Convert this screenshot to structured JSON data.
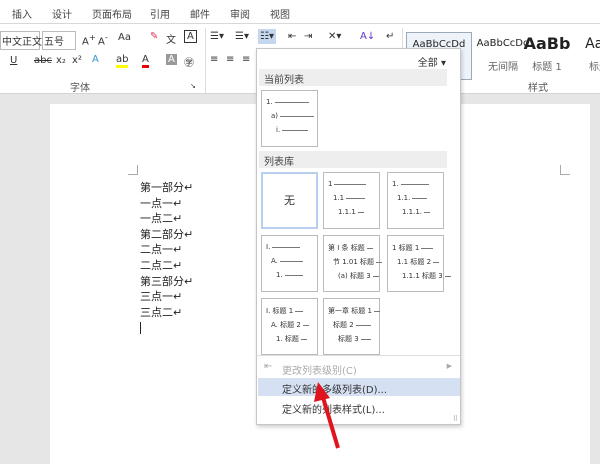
{
  "tabs": [
    "插入",
    "设计",
    "页面布局",
    "引用",
    "邮件",
    "审阅",
    "视图"
  ],
  "ribbon": {
    "font_name": "中文正文",
    "font_size": "五号",
    "change_case": "Aa",
    "group_font": "字体",
    "group_styles": "样式",
    "styles": [
      {
        "preview": "AaBbCcDd",
        "name": ""
      },
      {
        "preview": "AaBbCcDd",
        "name": "无间隔"
      },
      {
        "preview": "AaBb",
        "name": "标题 1"
      },
      {
        "preview": "AaB",
        "name": "标题"
      }
    ]
  },
  "document": {
    "lines": [
      "第一部分↵",
      "一点一↵",
      "一点二↵",
      "第二部分↵",
      "二点一↵",
      "二点二↵",
      "第三部分↵",
      "三点一↵",
      "三点二↵"
    ]
  },
  "menu": {
    "filter": "全部 ▾",
    "current_header": "当前列表",
    "library_header": "列表库",
    "current": [
      "1.",
      "a)",
      "i."
    ],
    "none": "无",
    "lib": [
      [
        "1",
        "1.1",
        "1.1.1"
      ],
      [
        "1.",
        "1.1.",
        "1.1.1."
      ],
      [
        "I.",
        "A.",
        "1."
      ],
      [
        "第 I 条 标题",
        "节 1.01 标题",
        "(a) 标题 3"
      ],
      [
        "1 标题 1",
        "1.1 标题 2",
        "1.1.1 标题 3"
      ],
      [
        "I. 标题 1",
        "A. 标题 2",
        "1. 标题"
      ],
      [
        "第一章 标题 1",
        "标题 2",
        "标题 3"
      ]
    ],
    "items": [
      "更改列表级别(C)",
      "定义新的多级列表(D)...",
      "定义新的列表样式(L)..."
    ]
  },
  "colors": {
    "accent": "#c5d7ee",
    "arrow": "#e0141e"
  }
}
